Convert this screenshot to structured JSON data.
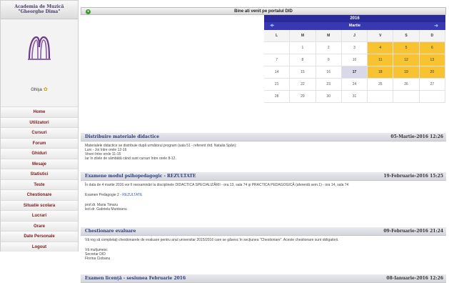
{
  "sidebar": {
    "title_line1": "Academia de Muzică",
    "title_line2": "\"Gheorghe Dima\"",
    "user": "Ghişa",
    "menu": [
      {
        "label": "Home"
      },
      {
        "label": "Utilizatori"
      },
      {
        "label": "Cursuri"
      },
      {
        "label": "Forum"
      },
      {
        "label": "Ghiduri"
      },
      {
        "label": "Mesaje"
      },
      {
        "label": "Statistici"
      },
      {
        "label": "Teste"
      },
      {
        "label": "Chestionare"
      },
      {
        "label": "Situatie scolara"
      },
      {
        "label": "Lucrari"
      },
      {
        "label": "Orare"
      },
      {
        "label": "Date Personale"
      },
      {
        "label": "Logout"
      }
    ]
  },
  "header": {
    "title": "Bine ati venit pe portalul DID"
  },
  "calendar": {
    "year": "2016",
    "month": "Martie",
    "weekdays": [
      "L",
      "M",
      "M",
      "J",
      "V",
      "S",
      "D"
    ],
    "weeks": [
      [
        "",
        "1",
        "2",
        "3",
        "4",
        "5",
        "6"
      ],
      [
        "7",
        "8",
        "9",
        "10",
        "11",
        "12",
        "13"
      ],
      [
        "14",
        "15",
        "16",
        "17",
        "18",
        "19",
        "20"
      ],
      [
        "21",
        "22",
        "23",
        "24",
        "25",
        "26",
        "27"
      ],
      [
        "28",
        "29",
        "30",
        "31",
        "",
        "",
        ""
      ]
    ],
    "highlight_color": "#f7c331",
    "today": "17"
  },
  "posts": [
    {
      "title": "Distribuire materiale didactice",
      "date": "05-Martie-2016 12:26",
      "lines": [
        "Materialele didactice se distribuie după următorul program (sala 51 - referent drd. Natalia Spân):",
        "Luni - Joi între orele 12-16",
        "Vineri între orele 11-15",
        "Iar în zilele de sâmbătă când sunt cursuri între orele 8-12."
      ]
    },
    {
      "title": "Examene modul psihopedagogic - REZULTATE",
      "date": "19-Februarie-2016 15:25",
      "para1": "În data de 4 martie 2016 vor fi reexaminări la disciplinele DIDACTICA SPECIALIZĂRII - ora 13, sala 74 şi PRACTICA PEDAGOGICĂ (aferentă sem.1) - ora 14, sala 74",
      "para2_prefix": "Examen Pedagogie 2 - ",
      "para2_link": "REZULTATE",
      "signature": [
        "prof.dr. Maria Timaru",
        "lect.dr. Gabriela Munteanu"
      ]
    },
    {
      "title": "Chestionare evaluare",
      "date": "09-Februarie-2016 21:24",
      "para1": "Vă rog să completaţi chestionarele de evaluare pentru anul universitar 2015/2016 care se găsesc în secţiunea \"Chestionare\". Aceste chestionare sunt obligatorii.",
      "signature": [
        "Vă mulţumesc",
        "Secretar DID",
        "Florina Ciobanu"
      ]
    },
    {
      "title": "Examen licenţă - sesiunea Februarie 2016",
      "date": "08-Ianuarie-2016 12:26"
    }
  ]
}
